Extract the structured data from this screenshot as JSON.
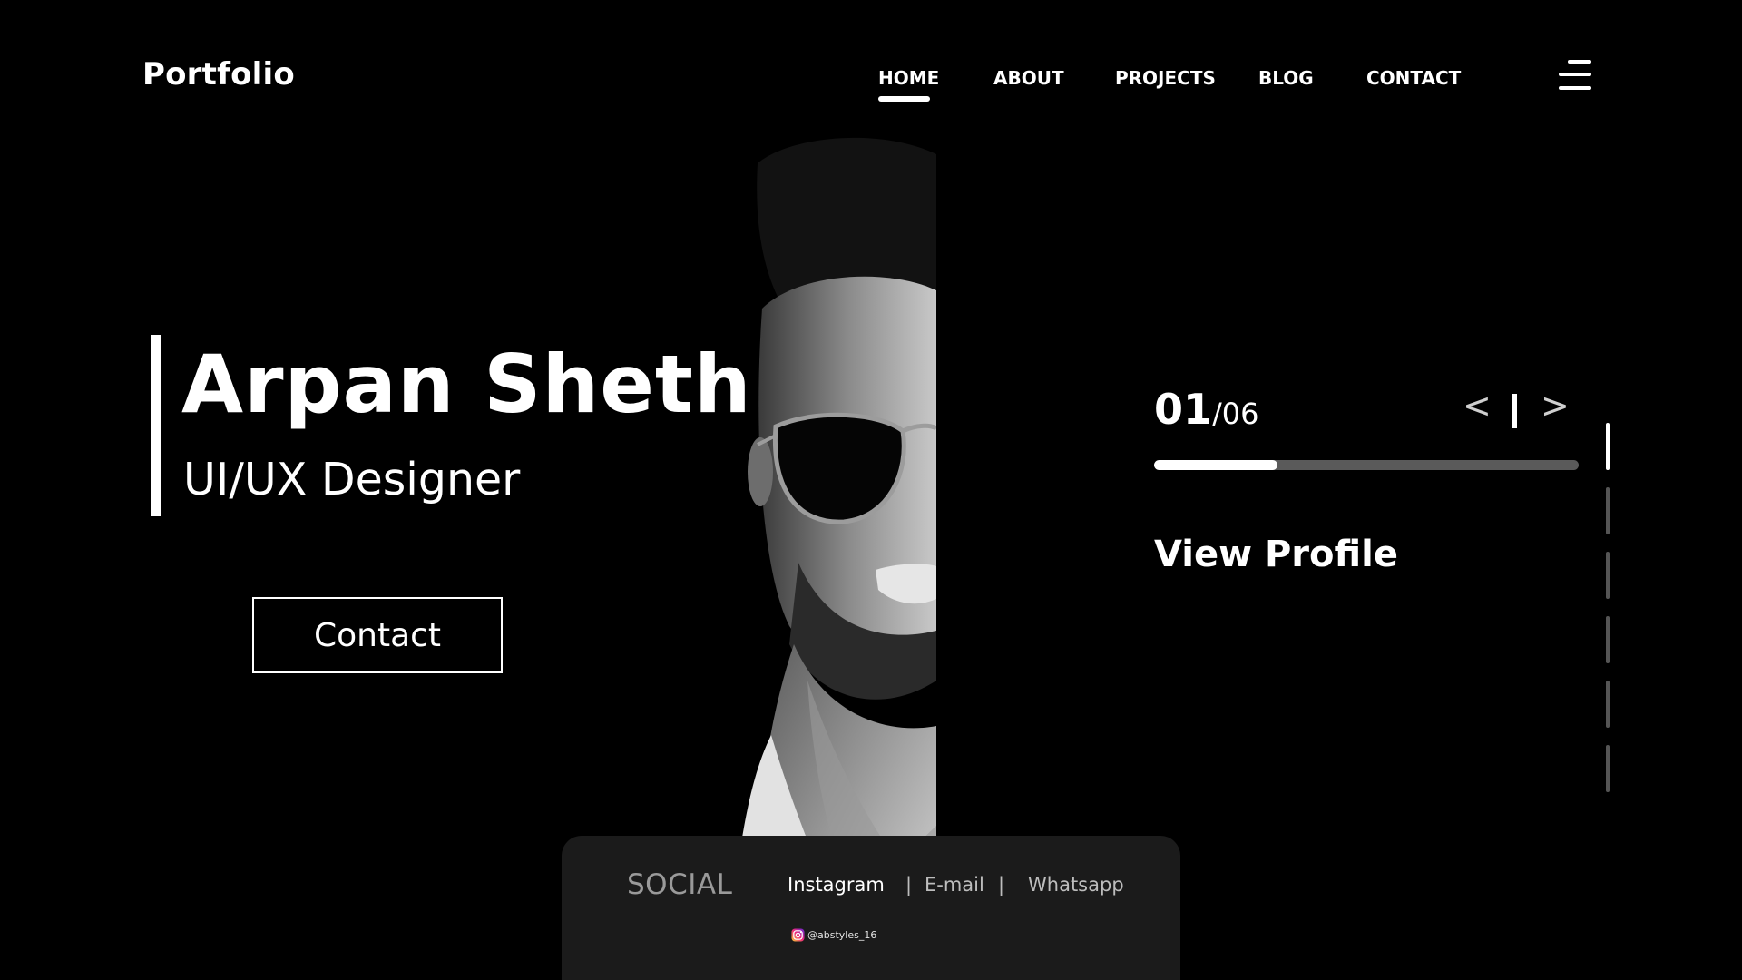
{
  "header": {
    "logo": "Portfolio",
    "nav": {
      "home": "HOME",
      "about": "ABOUT",
      "projects": "PROJECTS",
      "blog": "BLOG",
      "contact": "CONTACT"
    },
    "active_nav": "HOME",
    "menu_icon": "hamburger-menu-icon"
  },
  "hero": {
    "name": "Arpan Sheth",
    "role": "UI/UX Designer",
    "contact_button": "Contact"
  },
  "slider": {
    "current": "01",
    "separator": "/",
    "total": "06",
    "prev_label": "<",
    "next_label": ">",
    "progress": 0.29,
    "view_profile": "View Profile",
    "active_dot": 1,
    "dot_count": 6
  },
  "social": {
    "title": "SOCIAL",
    "instagram": "Instagram",
    "sep": "|",
    "email": "E-mail",
    "whatsapp": "Whatsapp",
    "handle": "@abstyles_16",
    "handle_icon": "instagram-icon"
  },
  "colors": {
    "background": "#000000",
    "text": "#ffffff",
    "card": "#1b1b1b",
    "muted": "#9a9a9a"
  }
}
